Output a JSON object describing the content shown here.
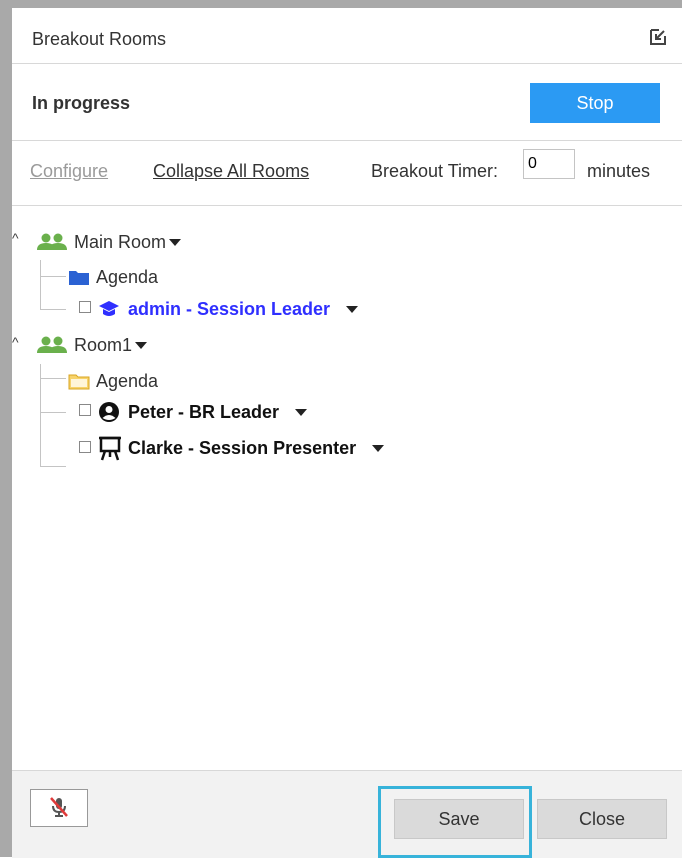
{
  "dialog": {
    "title": "Breakout Rooms"
  },
  "status": {
    "text": "In progress",
    "stop_label": "Stop"
  },
  "config": {
    "configure_label": "Configure",
    "collapse_label": "Collapse All Rooms",
    "timer_label": "Breakout Timer:",
    "timer_value": "0",
    "minutes_label": "minutes"
  },
  "rooms": [
    {
      "name": "Main Room",
      "agenda": "Agenda",
      "agenda_color": "#2b62d3",
      "members": [
        {
          "label": "admin - Session Leader",
          "icon": "graduation-cap-icon",
          "color": "#2f2fff"
        }
      ]
    },
    {
      "name": "Room1",
      "agenda": "Agenda",
      "agenda_color": "#f1c232",
      "members": [
        {
          "label": "Peter - BR Leader",
          "icon": "user-circle-icon",
          "color": "#111111"
        },
        {
          "label": "Clarke - Session Presenter",
          "icon": "presenter-easel-icon",
          "color": "#111111"
        }
      ]
    }
  ],
  "footer": {
    "save_label": "Save",
    "close_label": "Close"
  },
  "colors": {
    "accent": "#2b9af3",
    "room_icon": "#6ab04c",
    "highlight": "#37b3da"
  }
}
